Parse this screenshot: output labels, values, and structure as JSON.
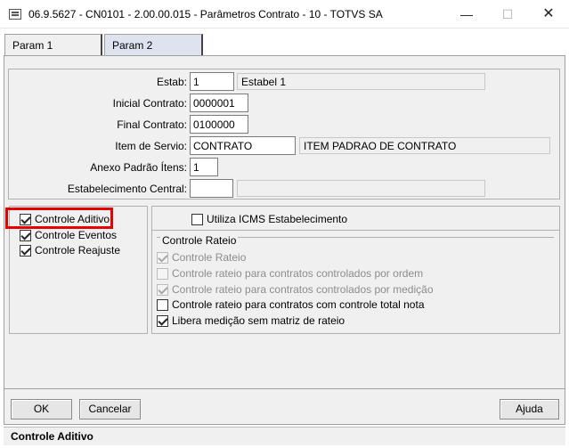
{
  "window": {
    "title": "06.9.5627 - CN0101 - 2.00.00.015 - Parâmetros Contrato - 10 - TOTVS SA",
    "minimize_glyph": "—",
    "maximize_glyph": "☐",
    "close_glyph": "✕"
  },
  "tabs": [
    {
      "label": "Param 1",
      "selected": true
    },
    {
      "label": "Param 2",
      "selected": false
    }
  ],
  "form": {
    "estab": {
      "label": "Estab:",
      "value": "1",
      "description": "Estabel 1"
    },
    "inicial_contrato": {
      "label": "Inicial Contrato:",
      "value": "0000001"
    },
    "final_contrato": {
      "label": "Final Contrato:",
      "value": "0100000"
    },
    "item_servio": {
      "label": "Item de Servio:",
      "value": "CONTRATO",
      "description": "ITEM PADRAO DE CONTRATO"
    },
    "anexo_padrao": {
      "label": "Anexo Padrão Ítens:",
      "value": "1"
    },
    "estab_central": {
      "label": "Estabelecimento Central:",
      "value": "",
      "description": ""
    }
  },
  "left_checks": [
    {
      "label": "Controle Aditivo",
      "checked": true
    },
    {
      "label": "Controle Eventos",
      "checked": true
    },
    {
      "label": "Controle Reajuste",
      "checked": true
    }
  ],
  "utiliza_icms": {
    "label": "Utiliza ICMS Estabelecimento",
    "checked": false
  },
  "rateio": {
    "legend": "Controle Rateio",
    "items": [
      {
        "label": "Controle Rateio",
        "checked": true,
        "enabled": false
      },
      {
        "label": "Controle rateio para contratos controlados por ordem",
        "checked": false,
        "enabled": false
      },
      {
        "label": "Controle rateio para contratos controlados por medição",
        "checked": true,
        "enabled": false
      },
      {
        "label": "Controle rateio para contratos com controle total nota",
        "checked": false,
        "enabled": true
      },
      {
        "label": "Libera medição sem matriz de rateio",
        "checked": true,
        "enabled": true
      }
    ]
  },
  "buttons": {
    "ok": "OK",
    "cancel": "Cancelar",
    "help": "Ajuda"
  },
  "status_text": "Controle Aditivo",
  "colors": {
    "highlight": "#e60000",
    "tab2_bg": "#dde4f0"
  }
}
